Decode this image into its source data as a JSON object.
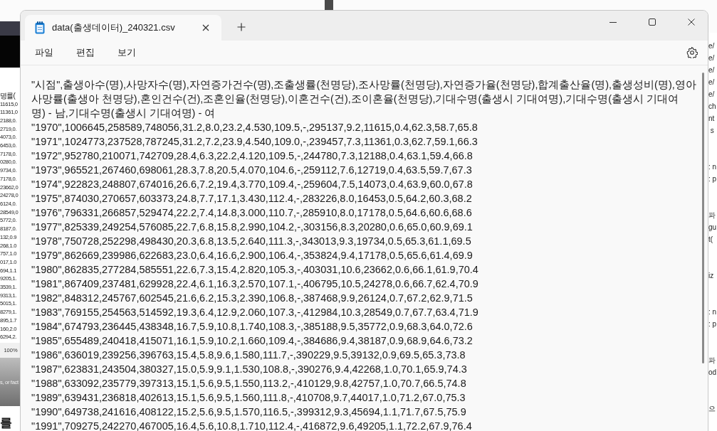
{
  "background_left": {
    "lines": [
      "명률(",
      "11615,0",
      "11361,0",
      "2188,0.",
      "2719,0.",
      "4073,0.",
      "6453,0.",
      "7178,0.",
      "0280,0.",
      "9734,0.",
      "7178,0.",
      "23662,0",
      "24278,0",
      "6124,0.",
      "28549,0",
      "5772,0.",
      "8187,0.",
      "132,0.9",
      "268,1.0",
      "757,1.0",
      "017,1.0",
      "694,1.1",
      "9205,1.",
      "3539,1.",
      "9313,1.",
      "5015,1.",
      "8279,1.",
      "895,1.7",
      "160,2.0",
      "6294,2."
    ],
    "zoom": "100%",
    "caption": "s, or fact",
    "heading": "를"
  },
  "background_right": {
    "blocks": [
      {
        "lines": [
          "e/",
          "e/",
          "e/",
          "e/",
          "e/",
          "ch",
          "nt",
          " s"
        ]
      },
      {
        "lines": [
          ": n",
          ": p"
        ]
      },
      {
        "lines": [
          "파",
          "gu",
          "t("
        ]
      },
      {
        "lines": [
          "iz"
        ]
      },
      {
        "lines": [
          ": n",
          ": p"
        ]
      },
      {
        "lines": [
          "파",
          "od"
        ]
      },
      {
        "lines": [
          "으"
        ]
      }
    ]
  },
  "window": {
    "tab_title": "data(출생데이터)_240321.csv"
  },
  "menu": [
    "파일",
    "편집",
    "보기"
  ],
  "editor": {
    "lines": [
      "\"시점\",출생아수(명),사망자수(명),자연증가건수(명),조출생률(천명당),조사망률(천명당),자연증가율(천명당),합계출산율(명),출생성비(명),영아",
      "사망률(출생아 천명당),혼인건수(건),조혼인율(천명당),이혼건수(건),조이혼율(천명당),기대수명(출생시 기대여명),기대수명(출생시 기대여",
      "명) - 남,기대수명(출생시 기대여명) - 여",
      "\"1970\",1006645,258589,748056,31.2,8.0,23.2,4.530,109.5,-,295137,9.2,11615,0.4,62.3,58.7,65.8",
      "\"1971\",1024773,237528,787245,31.2,7.2,23.9,4.540,109.0,-,239457,7.3,11361,0.3,62.7,59.1,66.3",
      "\"1972\",952780,210071,742709,28.4,6.3,22.2,4.120,109.5,-,244780,7.3,12188,0.4,63.1,59.4,66.8",
      "\"1973\",965521,267460,698061,28.3,7.8,20.5,4.070,104.6,-,259112,7.6,12719,0.4,63.5,59.7,67.3",
      "\"1974\",922823,248807,674016,26.6,7.2,19.4,3.770,109.4,-,259604,7.5,14073,0.4,63.9,60.0,67.8",
      "\"1975\",874030,270657,603373,24.8,7.7,17.1,3.430,112.4,-,283226,8.0,16453,0.5,64.2,60.3,68.2",
      "\"1976\",796331,266857,529474,22.2,7.4,14.8,3.000,110.7,-,285910,8.0,17178,0.5,64.6,60.6,68.6",
      "\"1977\",825339,249254,576085,22.7,6.8,15.8,2.990,104.2,-,303156,8.3,20280,0.6,65.0,60.9,69.1",
      "\"1978\",750728,252298,498430,20.3,6.8,13.5,2.640,111.3,-,343013,9.3,19734,0.5,65.3,61.1,69.5",
      "\"1979\",862669,239986,622683,23.0,6.4,16.6,2.900,106.4,-,353824,9.4,17178,0.5,65.6,61.4,69.9",
      "\"1980\",862835,277284,585551,22.6,7.3,15.4,2.820,105.3,-,403031,10.6,23662,0.6,66.1,61.9,70.4",
      "\"1981\",867409,237481,629928,22.4,6.1,16.3,2.570,107.1,-,406795,10.5,24278,0.6,66.7,62.4,70.9",
      "\"1982\",848312,245767,602545,21.6,6.2,15.3,2.390,106.8,-,387468,9.9,26124,0.7,67.2,62.9,71.5",
      "\"1983\",769155,254563,514592,19.3,6.4,12.9,2.060,107.3,-,412984,10.3,28549,0.7,67.7,63.4,71.9",
      "\"1984\",674793,236445,438348,16.7,5.9,10.8,1.740,108.3,-,385188,9.5,35772,0.9,68.3,64.0,72.6",
      "\"1985\",655489,240418,415071,16.1,5.9,10.2,1.660,109.4,-,384686,9.4,38187,0.9,68.9,64.6,73.2",
      "\"1986\",636019,239256,396763,15.4,5.8,9.6,1.580,111.7,-,390229,9.5,39132,0.9,69.5,65.3,73.8",
      "\"1987\",623831,243504,380327,15.0,5.9,9.1,1.530,108.8,-,390276,9.4,42268,1.0,70.1,65.9,74.3",
      "\"1988\",633092,235779,397313,15.1,5.6,9.5,1.550,113.2,-,410129,9.8,42757,1.0,70.7,66.5,74.8",
      "\"1989\",639431,236818,402613,15.1,5.6,9.5,1.560,111.8,-,410708,9.7,44017,1.0,71.2,67.0,75.3",
      "\"1990\",649738,241616,408122,15.2,5.6,9.5,1.570,116.5,-,399312,9.3,45694,1.1,71.7,67.5,75.9",
      "\"1991\",709275,242270,467005,16.4,5.6,10.8,1.710,112.4,-,416872,9.6,49205,1.1,72.2,67.9,76.4"
    ]
  }
}
